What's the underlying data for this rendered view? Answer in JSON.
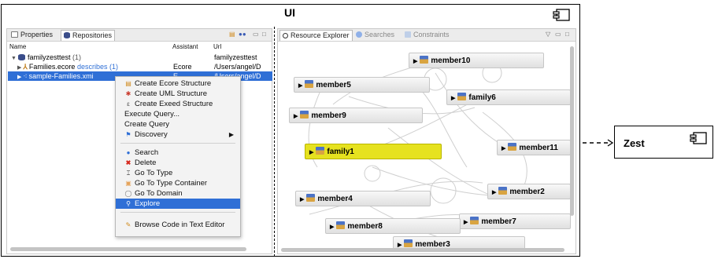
{
  "ui": {
    "title": "UI"
  },
  "zest": {
    "label": "Zest"
  },
  "left_panel": {
    "tabs": [
      "Properties",
      "Repositories"
    ],
    "columns": [
      "Name",
      "Assistant",
      "Url"
    ],
    "rows": [
      {
        "name": "familyzesttest",
        "count": "(1)",
        "assistant": "",
        "url": "familyzesttest"
      },
      {
        "name": "Families.ecore",
        "link": "describes (1)",
        "assistant": "Ecore",
        "url": "/Users/angel/D"
      },
      {
        "name": "sample-Families.xmi",
        "assistant": "E",
        "url": "/Users/angel/D"
      }
    ]
  },
  "context_menu": {
    "items": [
      {
        "label": "Create Ecore Structure",
        "icon": "ecore-structure-icon"
      },
      {
        "label": "Create UML Structure",
        "icon": "uml-structure-icon"
      },
      {
        "label": "Create Exeed Structure",
        "icon": "exeed-structure-icon"
      },
      {
        "label": "Execute Query...",
        "icon": ""
      },
      {
        "label": "Create Query",
        "icon": ""
      },
      {
        "label": "Discovery",
        "icon": "discovery-icon",
        "submenu": true
      },
      {
        "label": "Search",
        "icon": "search-icon"
      },
      {
        "label": "Delete",
        "icon": "delete-icon"
      },
      {
        "label": "Go To Type",
        "icon": "type-icon"
      },
      {
        "label": "Go To Type Container",
        "icon": "type-container-icon"
      },
      {
        "label": "Go To Domain",
        "icon": "domain-icon"
      },
      {
        "label": "Explore",
        "icon": "explore-icon",
        "highlighted": true
      },
      {
        "label": "Browse Code in Text Editor",
        "icon": "browse-code-icon"
      }
    ]
  },
  "right_panel": {
    "tabs": [
      "Resource Explorer",
      "Searches",
      "Constraints"
    ],
    "nodes": [
      {
        "label": "member10"
      },
      {
        "label": "member5"
      },
      {
        "label": "family6"
      },
      {
        "label": "member9"
      },
      {
        "label": "family1",
        "highlighted": true
      },
      {
        "label": "member11"
      },
      {
        "label": "member4"
      },
      {
        "label": "member2"
      },
      {
        "label": "member7"
      },
      {
        "label": "member8"
      },
      {
        "label": "member3"
      }
    ]
  },
  "colors": {
    "selection": "#2f6fd6",
    "highlight_node": "#e6e21f",
    "frame": "#000000"
  }
}
